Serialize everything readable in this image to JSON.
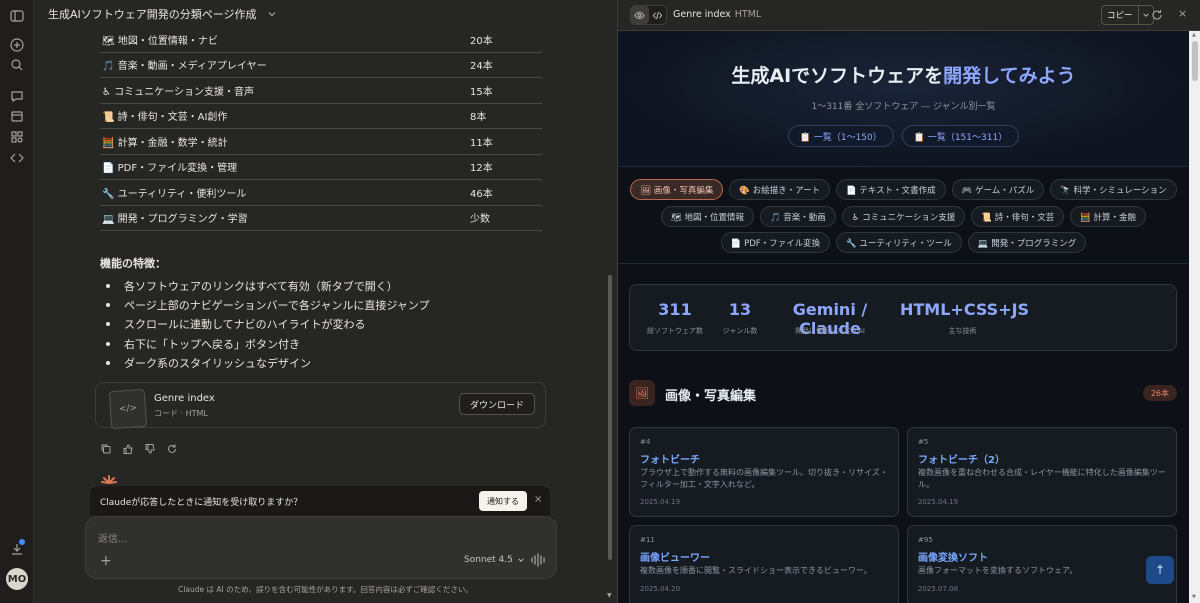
{
  "chat": {
    "title": "生成AIソフトウェア開発の分類ページ作成",
    "table_rows": [
      {
        "genre": "🗺 地図・位置情報・ナビ",
        "count": "20本"
      },
      {
        "genre": "🎵 音楽・動画・メディアプレイヤー",
        "count": "24本"
      },
      {
        "genre": "♿ コミュニケーション支援・音声",
        "count": "15本"
      },
      {
        "genre": "📜 詩・俳句・文芸・AI創作",
        "count": "8本"
      },
      {
        "genre": "🧮 計算・金融・数学・統計",
        "count": "11本"
      },
      {
        "genre": "📄 PDF・ファイル変換・管理",
        "count": "12本"
      },
      {
        "genre": "🔧 ユーティリティ・便利ツール",
        "count": "46本"
      },
      {
        "genre": "💻 開発・プログラミング・学習",
        "count": "少数"
      }
    ],
    "features_heading": "機能の特徴：",
    "features": [
      "各ソフトウェアのリンクはすべて有効（新タブで開く）",
      "ページ上部のナビゲーションバーで各ジャンルに直接ジャンプ",
      "スクロールに連動してナビのハイライトが変わる",
      "右下に「トップへ戻る」ボタン付き",
      "ダーク系のスタイリッシュなデザイン"
    ],
    "artifact": {
      "title": "Genre index",
      "subtitle": "コード · HTML",
      "download_label": "ダウンロード"
    },
    "notification": {
      "text": "Claudeが応答したときに通知を受け取りますか？",
      "button": "通知する",
      "close": "×"
    },
    "input": {
      "placeholder": "返信...",
      "add": "+",
      "model": "Sonnet 4.5"
    },
    "disclaimer": "Claude は AI のため、誤りを含む可能性があります。回答内容は必ずご確認ください。"
  },
  "user": {
    "initials": "MO"
  },
  "panel": {
    "title": "Genre index",
    "type": "HTML",
    "copy_label": "コピー",
    "close": "×"
  },
  "page": {
    "hero_title_plain": "生成AIでソフトウェアを",
    "hero_title_accent": "開発してみよう",
    "hero_sub": "1〜311番 全ソフトウェア ― ジャンル別一覧",
    "hero_buttons": [
      "📋 一覧（1〜150）",
      "📋 一覧（151〜311）"
    ],
    "nav_rows": [
      [
        "🖼 画像・写真編集",
        "🎨 お絵描き・アート",
        "📄 テキスト・文書作成",
        "🎮 ゲーム・パズル",
        "🔭 科学・シミュレーション"
      ],
      [
        "🗺 地図・位置情報",
        "🎵 音楽・動画",
        "♿ コミュニケーション支援",
        "📜 詩・俳句・文芸",
        "🧮 計算・金融"
      ],
      [
        "📄 PDF・ファイル変換",
        "🔧 ユーティリティ・ツール",
        "💻 開発・プログラミング"
      ]
    ],
    "stats": [
      {
        "num": "311",
        "label": "総ソフトウェア数"
      },
      {
        "num": "13",
        "label": "ジャンル数"
      },
      {
        "num": "Gemini / Claude",
        "label": "開発に使用した主なAI"
      },
      {
        "num": "HTML+CSS+JS",
        "label": "主な技術"
      }
    ],
    "section": {
      "icon": "🖼",
      "title": "画像・写真編集",
      "count": "26本"
    },
    "cards": [
      {
        "id": "#4",
        "name": "フォトビーチ",
        "desc": "ブラウザ上で動作する無料の画像編集ツール。切り抜き・リサイズ・フィルター加工・文字入れなど。",
        "date": "2025.04.19"
      },
      {
        "id": "#5",
        "name": "フォトビーチ（2）",
        "desc": "複数画像を重ね合わせる合成・レイヤー機能に特化した画像編集ツール。",
        "date": "2025.04.19"
      },
      {
        "id": "#11",
        "name": "画像ビューワー",
        "desc": "複数画像を順番に閲覧・スライドショー表示できるビューワー。",
        "date": "2025.04.20"
      },
      {
        "id": "#95",
        "name": "画像変換ソフト",
        "desc": "画像フォーマットを変換するソフトウェア。",
        "date": "2025.07.08"
      }
    ],
    "to_top": "↑"
  }
}
